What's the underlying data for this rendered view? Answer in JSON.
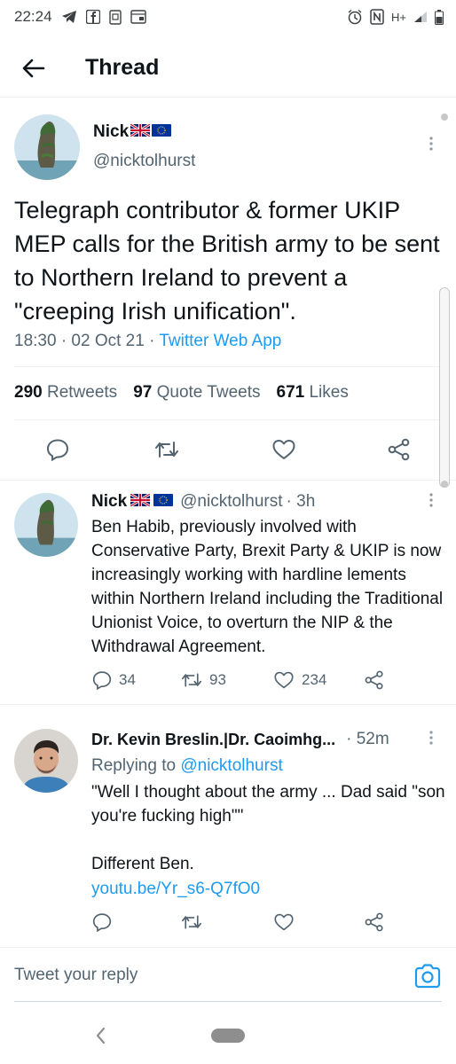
{
  "status_bar": {
    "time": "22:24",
    "network": "H+"
  },
  "header": {
    "title": "Thread"
  },
  "main_tweet": {
    "author_name": "Nick",
    "author_handle": "@nicktolhurst",
    "text": "Telegraph contributor & former UKIP MEP calls for the British army to be sent to Northern Ireland to prevent a \"creeping Irish unification\".",
    "time": "18:30 · 02 Oct 21 · ",
    "source": "Twitter Web App",
    "retweets_count": "290",
    "retweets_label": "Retweets",
    "quotes_count": "97",
    "quotes_label": "Quote Tweets",
    "likes_count": "671",
    "likes_label": "Likes"
  },
  "replies": [
    {
      "author_name": "Nick",
      "author_handle": "@nicktolhurst",
      "age": "· 3h",
      "text": "Ben Habib, previously involved with Conservative Party, Brexit Party & UKIP is now increasingly working with hardline lements within Northern Ireland including the Traditional Unionist Voice, to overturn the NIP & the Withdrawal Agreement.",
      "replies_count": "34",
      "retweets_count": "93",
      "likes_count": "234"
    },
    {
      "author_name": "Dr. Kevin Breslin.|Dr. Caoimhg...",
      "age": "· 52m",
      "replying_prefix": "Replying to ",
      "replying_handle": "@nicktolhurst",
      "text_line1": "\"Well I thought about the army ... Dad said \"son you're fucking high\"\"",
      "text_line2": "Different Ben.",
      "link": "youtu.be/Yr_s6-Q7fO0"
    }
  ],
  "compose": {
    "placeholder": "Tweet your reply"
  },
  "colors": {
    "accent": "#1d9bf0",
    "text": "#0f1419",
    "secondary": "#536471",
    "divider": "#eff3f4"
  }
}
